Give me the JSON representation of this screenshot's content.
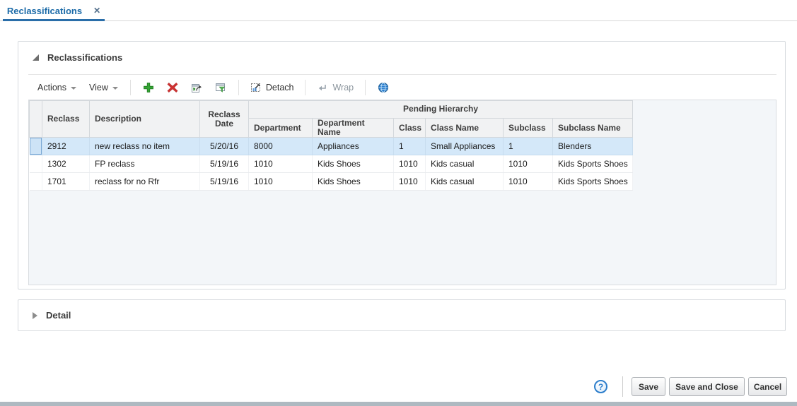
{
  "tab": {
    "label": "Reclassifications"
  },
  "icons": {
    "close": "✕",
    "help": "?"
  },
  "panel": {
    "title": "Reclassifications"
  },
  "toolbar": {
    "actions": "Actions",
    "view": "View",
    "detach": "Detach",
    "wrap": "Wrap"
  },
  "table": {
    "group_header": "Pending Hierarchy",
    "headers": {
      "reclass": "Reclass",
      "description": "Description",
      "reclass_date": "Reclass Date",
      "department": "Department",
      "department_name": "Department Name",
      "class": "Class",
      "class_name": "Class Name",
      "subclass": "Subclass",
      "subclass_name": "Subclass Name"
    },
    "rows": [
      {
        "reclass": "2912",
        "description": "new reclass no item",
        "reclass_date": "5/20/16",
        "department": "8000",
        "department_name": "Appliances",
        "class": "1",
        "class_name": "Small Appliances",
        "subclass": "1",
        "subclass_name": "Blenders"
      },
      {
        "reclass": "1302",
        "description": "FP reclass",
        "reclass_date": "5/19/16",
        "department": "1010",
        "department_name": "Kids Shoes",
        "class": "1010",
        "class_name": "Kids casual",
        "subclass": "1010",
        "subclass_name": "Kids Sports Shoes"
      },
      {
        "reclass": "1701",
        "description": "reclass for no Rfr",
        "reclass_date": "5/19/16",
        "department": "1010",
        "department_name": "Kids Shoes",
        "class": "1010",
        "class_name": "Kids casual",
        "subclass": "1010",
        "subclass_name": "Kids Sports Shoes"
      }
    ]
  },
  "detail": {
    "title": "Detail"
  },
  "footer": {
    "save": "Save",
    "save_and_close": "Save and Close",
    "cancel": "Cancel"
  },
  "colors": {
    "accent_blue": "#1c6ba8",
    "selected_row": "#d4e8f9",
    "add_green": "#35a435",
    "delete_red": "#ce3232"
  }
}
